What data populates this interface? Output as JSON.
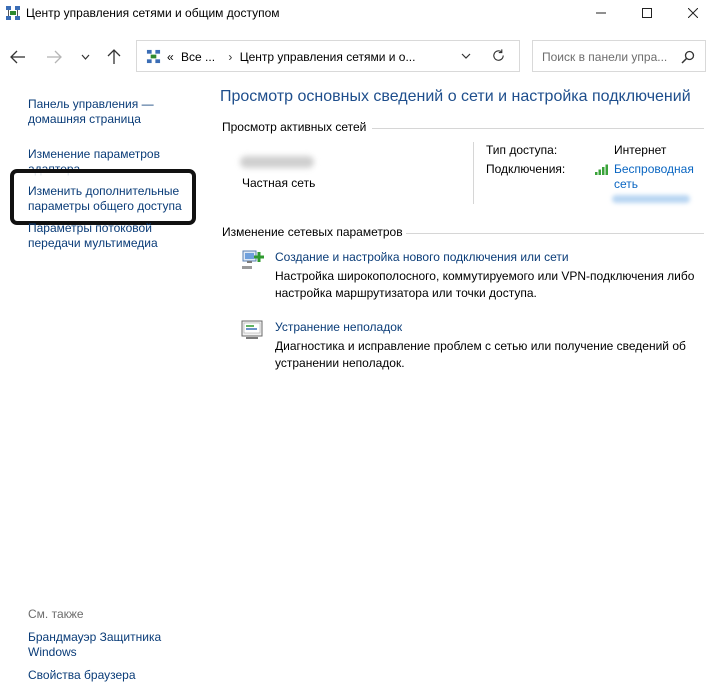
{
  "window": {
    "title": "Центр управления сетями и общим доступом",
    "icon": "network-center-icon"
  },
  "nav": {
    "back_icon": "arrow-left-icon",
    "forward_icon": "arrow-right-icon",
    "recent_icon": "chevron-down-icon",
    "up_icon": "arrow-up-icon"
  },
  "address": {
    "overflow": "«",
    "crumbs": [
      "Все ...",
      "Центр управления сетями и о..."
    ]
  },
  "search": {
    "placeholder": "Поиск в панели упра..."
  },
  "sidebar": {
    "links": [
      "Панель управления — домашняя страница",
      "Изменение параметров адаптера",
      "Изменить дополнительные параметры общего доступа",
      "Параметры потоковой передачи мультимедиа"
    ],
    "see_also_label": "См. также",
    "see_also": [
      "Брандмауэр Защитника Windows",
      "Свойства браузера"
    ]
  },
  "main": {
    "title": "Просмотр основных сведений о сети и настройка подключений",
    "active_section": "Просмотр активных сетей",
    "network": {
      "type": "Частная сеть",
      "access_label": "Тип доступа:",
      "access_value": "Интернет",
      "connections_label": "Подключения:",
      "connections_value": "Беспроводная сеть"
    },
    "change_section": "Изменение сетевых параметров",
    "tasks": [
      {
        "link": "Создание и настройка нового подключения или сети",
        "desc": "Настройка широкополосного, коммутируемого или VPN-подключения либо настройка маршрутизатора или точки доступа.",
        "icon": "new-connection-icon"
      },
      {
        "link": "Устранение неполадок",
        "desc": "Диагностика и исправление проблем с сетью или получение сведений об устранении неполадок.",
        "icon": "troubleshoot-icon"
      }
    ]
  },
  "colors": {
    "title_blue": "#1e4e8c",
    "link_blue": "#0a3c78",
    "wifi_green": "#3aa33a"
  }
}
